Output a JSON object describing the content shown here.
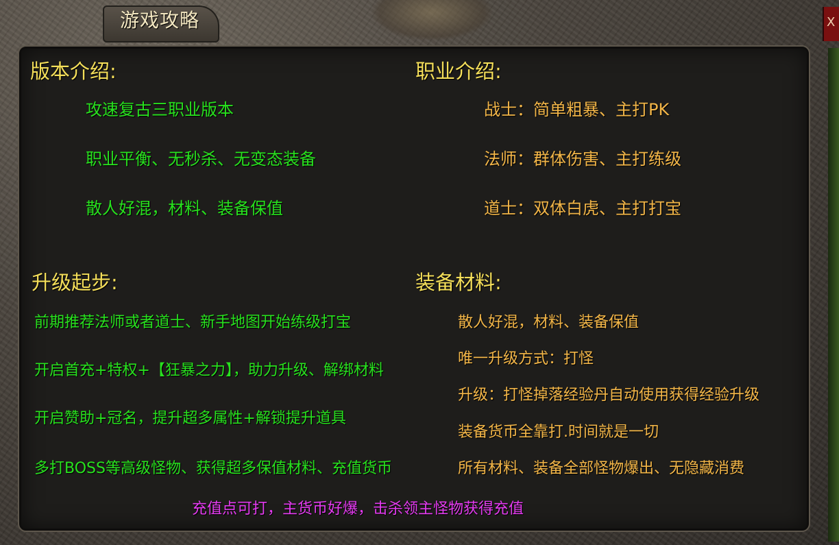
{
  "window": {
    "title": "游戏攻略",
    "close_label": "X"
  },
  "sections": {
    "version": {
      "heading": "版本介绍:",
      "items": [
        "攻速复古三职业版本",
        "职业平衡、无秒杀、无变态装备",
        "散人好混，材料、装备保值"
      ]
    },
    "classes": {
      "heading": "职业介绍:",
      "items": [
        "战士：简单粗暴、主打PK",
        "法师：群体伤害、主打练级",
        "道士：双体白虎、主打打宝"
      ]
    },
    "leveling": {
      "heading": "升级起步:",
      "items": [
        "前期推荐法师或者道士、新手地图开始练级打宝",
        "开启首充+特权+【狂暴之力】，助力升级、解绑材料",
        "开启赞助+冠名，提升超多属性+解锁提升道具",
        "多打BOSS等高级怪物、获得超多保值材料、充值货币"
      ]
    },
    "equipment": {
      "heading": "装备材料:",
      "items": [
        "散人好混，材料、装备保值",
        "唯一升级方式：打怪",
        "升级：打怪掉落经验丹自动使用获得经验升级",
        "装备货币全靠打.时间就是一切",
        "所有材料、装备全部怪物爆出、无隐藏消费"
      ]
    },
    "footer_note": "充值点可打，主货币好爆，击杀领主怪物获得充值"
  },
  "colors": {
    "heading": "#f5df5a",
    "green_text": "#28e11e",
    "orange_text": "#f3b648",
    "magenta_text": "#e43bf0"
  }
}
